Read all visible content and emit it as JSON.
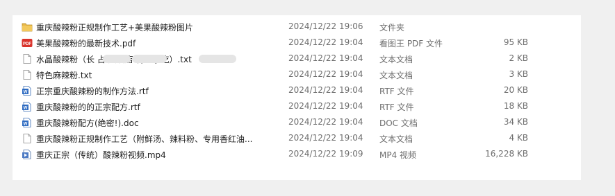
{
  "files": [
    {
      "name": "重庆酸辣粉正规制作工艺+美果酸辣粉图片",
      "date": "2024/12/22 19:06",
      "type": "文件夹",
      "size": "",
      "icon": "folder-icon"
    },
    {
      "name": "美果酸辣粉的最新技术.pdf",
      "date": "2024/12/22 19:04",
      "type": "看图王 PDF 文件",
      "size": "95 KB",
      "icon": "pdf-icon"
    },
    {
      "name": "水晶酸辣粉（长      占        大酒店       特色小吃）.txt",
      "date": "2024/12/22 19:04",
      "type": "文本文档",
      "size": "2 KB",
      "icon": "text-file-icon"
    },
    {
      "name": "特色麻辣粉.txt",
      "date": "2024/12/22 19:04",
      "type": "文本文档",
      "size": "3 KB",
      "icon": "text-file-icon"
    },
    {
      "name": "正宗重庆酸辣粉的制作方法.rtf",
      "date": "2024/12/22 19:04",
      "type": "RTF 文件",
      "size": "20 KB",
      "icon": "rtf-file-icon"
    },
    {
      "name": "重庆酸辣粉的的正宗配方.rtf",
      "date": "2024/12/22 19:04",
      "type": "RTF 文件",
      "size": "18 KB",
      "icon": "rtf-file-icon"
    },
    {
      "name": "重庆酸辣粉配方(绝密!).doc",
      "date": "2024/12/22 19:04",
      "type": "DOC 文档",
      "size": "34 KB",
      "icon": "doc-file-icon"
    },
    {
      "name": "重庆酸辣粉正规制作工艺（附鲜汤、辣料粉、专用香红油...",
      "date": "2024/12/22 19:04",
      "type": "文本文档",
      "size": "4 KB",
      "icon": "text-file-icon"
    },
    {
      "name": "重庆正宗（传统）酸辣粉视频.mp4",
      "date": "2024/12/22 19:09",
      "type": "MP4 视频",
      "size": "16,228 KB",
      "icon": "video-file-icon"
    }
  ]
}
